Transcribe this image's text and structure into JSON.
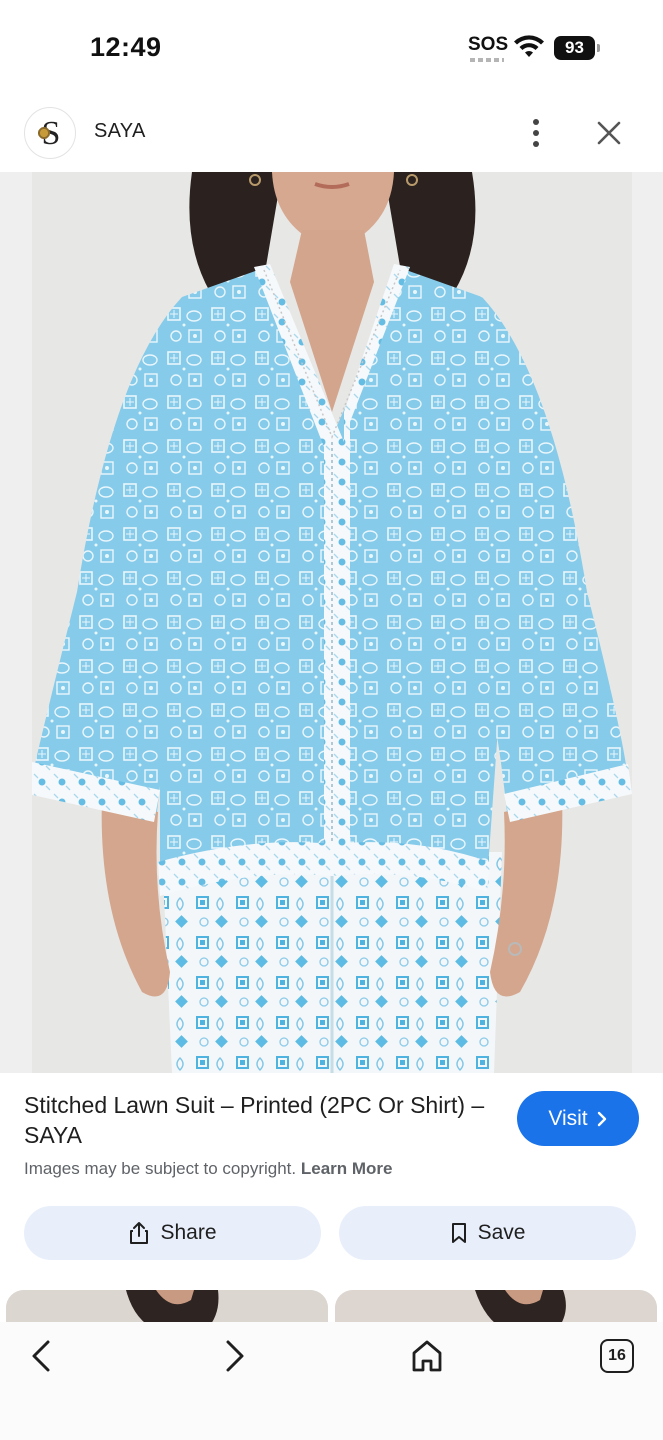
{
  "status_bar": {
    "time": "12:49",
    "sos": "SOS",
    "battery": "93"
  },
  "header": {
    "site_name": "SAYA",
    "logo_letter": "S"
  },
  "product": {
    "title": "Stitched Lawn Suit – Printed (2PC Or Shirt) – SAYA",
    "visit_label": "Visit",
    "copyright_text": "Images may be subject to copyright.",
    "learn_more": "Learn More"
  },
  "actions": {
    "share_label": "Share",
    "save_label": "Save"
  },
  "bottom_nav": {
    "tabs_count": "16"
  },
  "colors": {
    "accent": "#1a73e8",
    "action_bg": "#e8effb",
    "fabric_blue": "#7ec8e8"
  }
}
